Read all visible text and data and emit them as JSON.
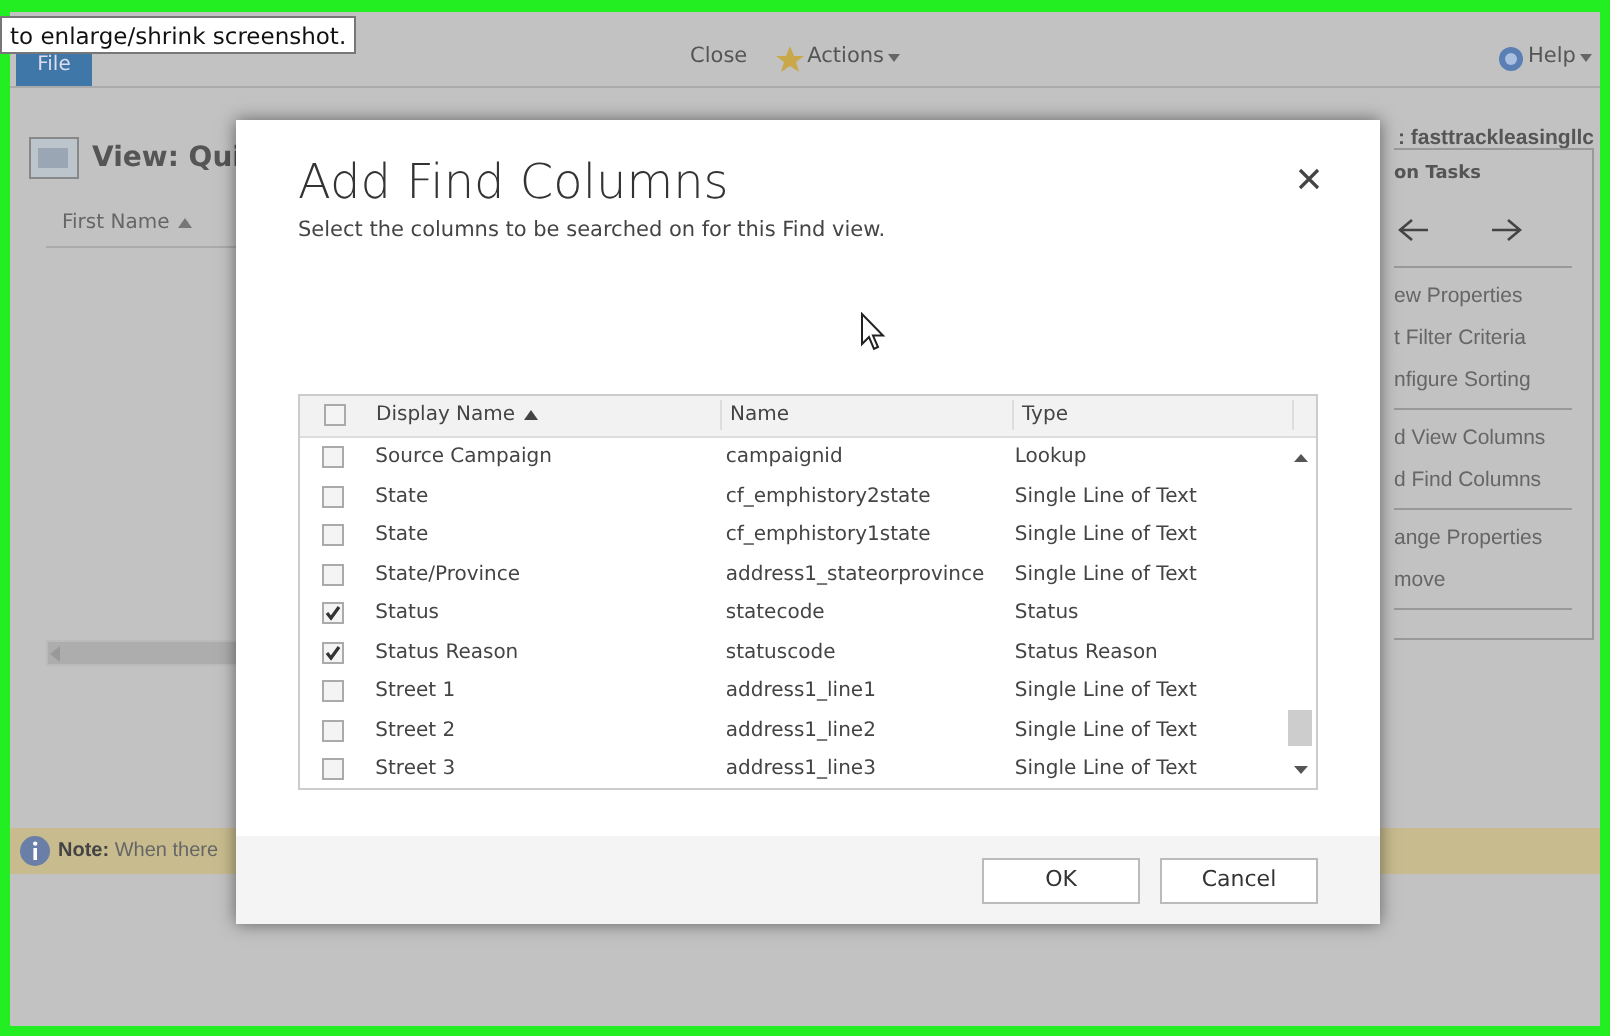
{
  "tooltip": "to enlarge/shrink screenshot.",
  "toolbar": {
    "file_tab": "File",
    "close": "Close",
    "actions": "Actions",
    "help": "Help"
  },
  "view_title": "View: Qui",
  "organization": ": fasttrackleasingllc",
  "grid": {
    "column": "First Name"
  },
  "tasks": {
    "title": "on Tasks",
    "groups": [
      [
        "ew Properties",
        "t Filter Criteria",
        "nfigure Sorting"
      ],
      [
        "d View Columns",
        "d Find Columns"
      ],
      [
        "ange Properties",
        "move"
      ]
    ]
  },
  "note": {
    "label": "Note:",
    "text": "When there"
  },
  "dialog": {
    "title": "Add Find Columns",
    "subtitle": "Select the columns to be searched on for this Find view.",
    "header_checked": false,
    "columns": [
      "Display Name",
      "Name",
      "Type"
    ],
    "rows": [
      {
        "display_name": "Source Campaign",
        "name": "campaignid",
        "type": "Lookup",
        "checked": false
      },
      {
        "display_name": "State",
        "name": "cf_emphistory2state",
        "type": "Single Line of Text",
        "checked": false
      },
      {
        "display_name": "State",
        "name": "cf_emphistory1state",
        "type": "Single Line of Text",
        "checked": false
      },
      {
        "display_name": "State/Province",
        "name": "address1_stateorprovince",
        "type": "Single Line of Text",
        "checked": false
      },
      {
        "display_name": "Status",
        "name": "statecode",
        "type": "Status",
        "checked": true
      },
      {
        "display_name": "Status Reason",
        "name": "statuscode",
        "type": "Status Reason",
        "checked": true
      },
      {
        "display_name": "Street 1",
        "name": "address1_line1",
        "type": "Single Line of Text",
        "checked": false
      },
      {
        "display_name": "Street 2",
        "name": "address1_line2",
        "type": "Single Line of Text",
        "checked": false
      },
      {
        "display_name": "Street 3",
        "name": "address1_line3",
        "type": "Single Line of Text",
        "checked": false
      }
    ],
    "buttons": [
      "OK",
      "Cancel"
    ]
  }
}
